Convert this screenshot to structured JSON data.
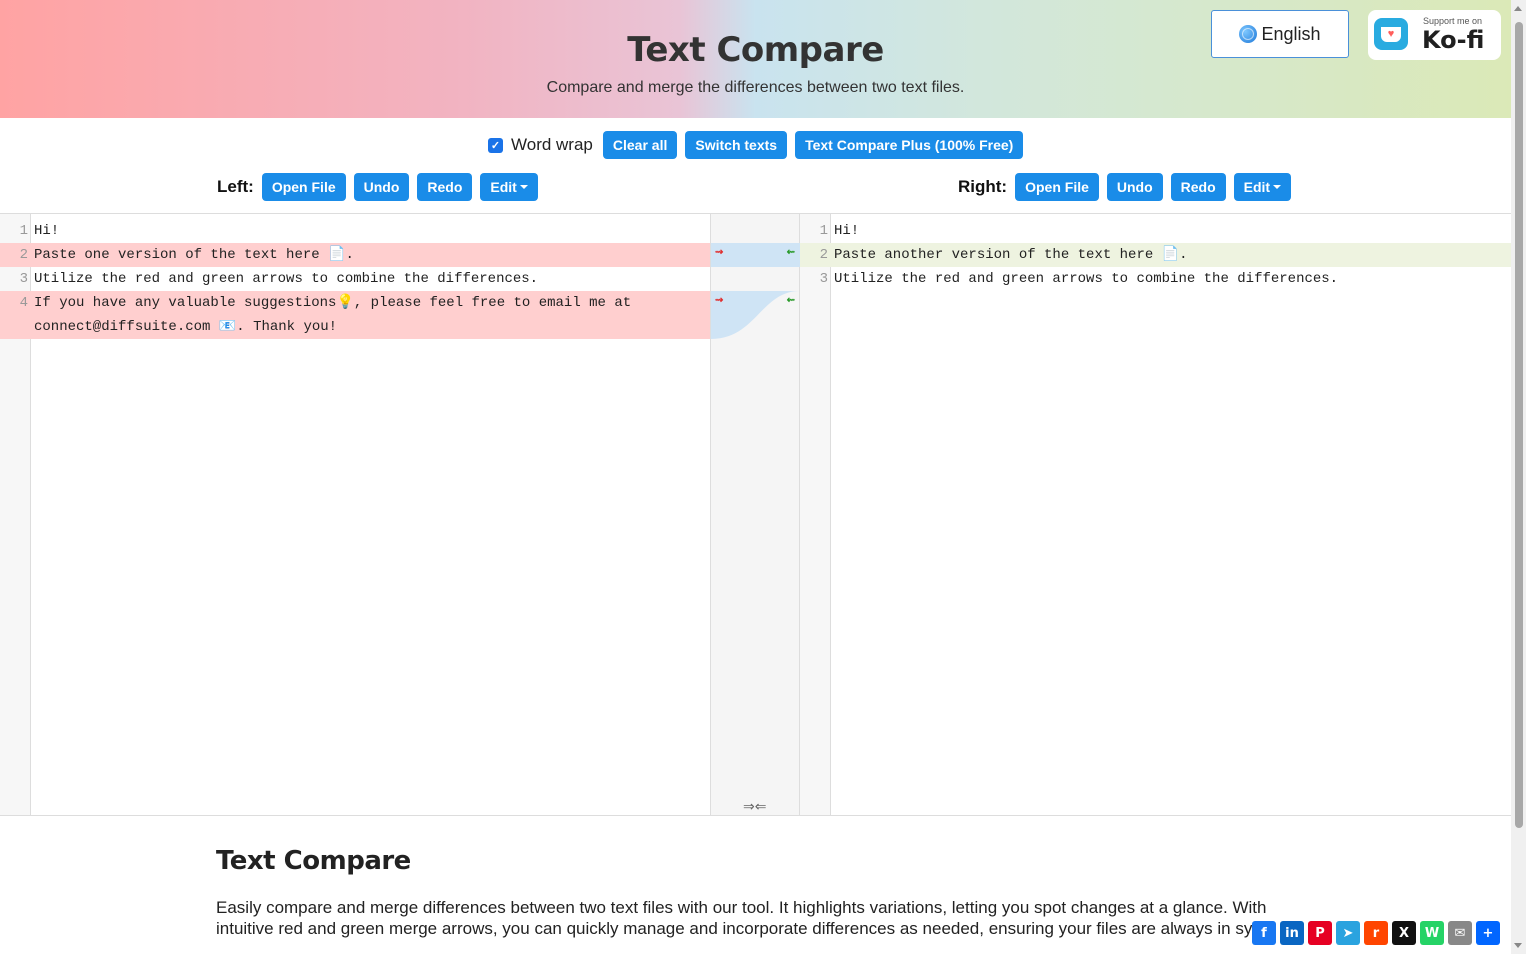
{
  "header": {
    "title": "Text Compare",
    "subtitle": "Compare and merge the differences between two text files.",
    "language": "English",
    "kofi_small": "Support me on",
    "kofi_big": "Ko-fi"
  },
  "toolbar": {
    "word_wrap_label": "Word wrap",
    "word_wrap_checked": true,
    "clear_all": "Clear all",
    "switch_texts": "Switch texts",
    "plus": "Text Compare Plus (100% Free)"
  },
  "left": {
    "label": "Left:",
    "open_file": "Open File",
    "undo": "Undo",
    "redo": "Redo",
    "edit": "Edit",
    "lines": [
      {
        "num": "1",
        "text": "Hi!"
      },
      {
        "num": "2",
        "text": "Paste one version of the text here 📄."
      },
      {
        "num": "3",
        "text": "Utilize the red and green arrows to combine the differences."
      },
      {
        "num": "4",
        "text": "If you have any valuable suggestions💡, please feel free to email me at"
      },
      {
        "num": "",
        "text": "connect@diffsuite.com 📧. Thank you!"
      }
    ]
  },
  "right": {
    "label": "Right:",
    "open_file": "Open File",
    "undo": "Undo",
    "redo": "Redo",
    "edit": "Edit",
    "lines": [
      {
        "num": "1",
        "text": "Hi!"
      },
      {
        "num": "2",
        "text": "Paste another version of the text here 📄."
      },
      {
        "num": "3",
        "text": "Utilize the red and green arrows to combine the differences."
      }
    ]
  },
  "merge": {
    "arrow_right": "⇝",
    "arrow_left": "⇜",
    "merge_all_icon": "⇒⇐"
  },
  "description": {
    "title": "Text Compare",
    "text": "Easily compare and merge differences between two text files with our tool. It highlights variations, letting you spot changes at a glance. With intuitive red and green merge arrows, you can quickly manage and incorporate differences as needed, ensuring your files are always in sync."
  },
  "share": [
    "f",
    "in",
    "P",
    "➤",
    "r",
    "X",
    "W",
    "✉",
    "+"
  ],
  "colors": {
    "button": "#1a8ce8",
    "deleted": "#ffcfcf",
    "added": "#eef3e0"
  }
}
